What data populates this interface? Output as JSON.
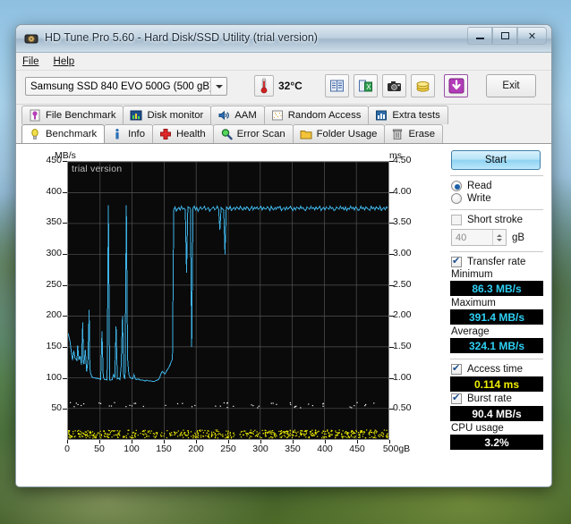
{
  "window": {
    "title": "HD Tune Pro 5.60 - Hard Disk/SSD Utility (trial version)",
    "app_icon": "harddisk-icon",
    "minimize_label": "Minimize",
    "maximize_label": "Maximize",
    "close_label": "✕"
  },
  "menu": {
    "items": [
      {
        "label": "File"
      },
      {
        "label": "Help"
      }
    ]
  },
  "toolbar": {
    "drive_selected": "Samsung SSD 840 EVO 500G (500 gB)",
    "temperature": "32°C",
    "buttons": [
      {
        "name": "copy-report-icon",
        "label": "Copy"
      },
      {
        "name": "export-excel-icon",
        "label": "Export"
      },
      {
        "name": "screenshot-icon",
        "label": "Screenshot"
      },
      {
        "name": "info-coins-icon",
        "label": "Options"
      },
      {
        "name": "download-icon",
        "label": "Save"
      }
    ],
    "exit_label": "Exit"
  },
  "tabs": {
    "top_row": [
      {
        "label": "File Benchmark",
        "icon": "file-benchmark-icon",
        "active": false
      },
      {
        "label": "Disk monitor",
        "icon": "disk-monitor-icon",
        "active": false
      },
      {
        "label": "AAM",
        "icon": "speaker-icon",
        "active": false
      },
      {
        "label": "Random Access",
        "icon": "random-access-icon",
        "active": false
      },
      {
        "label": "Extra tests",
        "icon": "extra-tests-icon",
        "active": false
      }
    ],
    "bottom_row": [
      {
        "label": "Benchmark",
        "icon": "lightbulb-icon",
        "active": true
      },
      {
        "label": "Info",
        "icon": "info-icon",
        "active": false
      },
      {
        "label": "Health",
        "icon": "health-cross-icon",
        "active": false
      },
      {
        "label": "Error Scan",
        "icon": "magnifier-icon",
        "active": false
      },
      {
        "label": "Folder Usage",
        "icon": "folder-icon",
        "active": false
      },
      {
        "label": "Erase",
        "icon": "trash-icon",
        "active": false
      }
    ]
  },
  "sidebar": {
    "start_label": "Start",
    "mode": {
      "read_label": "Read",
      "write_label": "Write",
      "read_selected": true,
      "write_selected": false
    },
    "short_stroke": {
      "label": "Short stroke",
      "checked": false,
      "value": "40",
      "unit": "gB"
    },
    "transfer_rate": {
      "label": "Transfer rate",
      "checked": true
    },
    "stats": [
      {
        "label": "Minimum",
        "value": "86.3 MB/s",
        "color": "cyan"
      },
      {
        "label": "Maximum",
        "value": "391.4 MB/s",
        "color": "cyan"
      },
      {
        "label": "Average",
        "value": "324.1 MB/s",
        "color": "cyan"
      }
    ],
    "access_time": {
      "label": "Access time",
      "checked": true,
      "value": "0.114 ms",
      "color": "yellow"
    },
    "burst_rate": {
      "label": "Burst rate",
      "checked": true,
      "value": "90.4 MB/s",
      "color": "white"
    },
    "cpu_usage": {
      "label": "CPU usage",
      "value": "3.2%",
      "color": "white"
    }
  },
  "chart_data": {
    "type": "line",
    "title": "",
    "watermark": "trial version",
    "xlabel": "",
    "ylabel": "MB/s",
    "y2label": "ms",
    "xlim": [
      0,
      500
    ],
    "ylim": [
      0,
      450
    ],
    "y2lim": [
      0,
      4.5
    ],
    "x_unit": "gB",
    "xticks": [
      "0",
      "50",
      "100",
      "150",
      "200",
      "250",
      "300",
      "350",
      "400",
      "450",
      "500gB"
    ],
    "xtick_values": [
      0,
      50,
      100,
      150,
      200,
      250,
      300,
      350,
      400,
      450,
      500
    ],
    "yticks": [
      "50",
      "100",
      "150",
      "200",
      "250",
      "300",
      "350",
      "400",
      "450"
    ],
    "ytick_values": [
      50,
      100,
      150,
      200,
      250,
      300,
      350,
      400,
      450
    ],
    "y2ticks": [
      "0.50",
      "1.00",
      "1.50",
      "2.00",
      "2.50",
      "3.00",
      "3.50",
      "4.00",
      "4.50"
    ],
    "y2tick_values": [
      0.5,
      1.0,
      1.5,
      2.0,
      2.5,
      3.0,
      3.5,
      4.0,
      4.5
    ],
    "grid": true,
    "legend_position": "none",
    "colors": {
      "transfer_rate": "#3fb4e8",
      "access_time": "#f2f200",
      "background": "#0a0a0a",
      "grid": "#6d6d6d"
    },
    "series": [
      {
        "name": "Transfer rate",
        "axis": "left",
        "unit": "MB/s",
        "color": "#3fb4e8",
        "x": [
          0,
          3,
          5,
          7,
          9,
          11,
          13,
          14,
          15,
          17,
          19,
          21,
          23,
          24,
          25,
          27,
          29,
          31,
          33,
          34,
          35,
          37,
          39,
          41,
          43,
          45,
          47,
          49,
          51,
          53,
          55,
          57,
          59,
          61,
          63,
          65,
          67,
          69,
          71,
          73,
          75,
          77,
          79,
          81,
          83,
          85,
          87,
          89,
          91,
          93,
          95,
          97,
          99,
          101,
          103,
          105,
          107,
          109,
          111,
          113,
          115,
          117,
          119,
          121,
          123,
          125,
          127,
          129,
          131,
          133,
          135,
          137,
          139,
          141,
          143,
          145,
          147,
          149,
          151,
          153,
          155,
          157,
          159,
          161,
          163,
          165,
          167,
          169,
          171,
          173,
          175,
          177,
          179,
          181,
          183,
          185,
          187,
          189,
          191,
          193,
          195,
          197,
          199,
          201,
          203,
          205,
          207,
          209,
          211,
          213,
          215,
          217,
          219,
          221,
          223,
          225,
          227,
          229,
          231,
          233,
          235,
          237,
          239,
          241,
          243,
          245,
          247,
          249,
          251,
          253,
          255,
          257,
          259,
          261,
          263,
          265,
          267,
          269,
          271,
          273,
          275,
          277,
          279,
          281,
          283,
          285,
          287,
          289,
          291,
          293,
          295,
          297,
          299,
          301,
          303,
          305,
          307,
          309,
          311,
          313,
          315,
          317,
          319,
          321,
          323,
          325,
          327,
          329,
          331,
          333,
          335,
          337,
          339,
          341,
          343,
          345,
          347,
          349,
          351,
          353,
          355,
          357,
          359,
          361,
          363,
          365,
          367,
          369,
          371,
          373,
          375,
          377,
          379,
          381,
          383,
          385,
          387,
          389,
          391,
          393,
          395,
          397,
          399,
          401,
          403,
          405,
          407,
          409,
          411,
          413,
          415,
          417,
          419,
          421,
          423,
          425,
          427,
          429,
          431,
          433,
          435,
          437,
          439,
          441,
          443,
          445,
          447,
          449,
          451,
          453,
          455,
          457,
          459,
          461,
          463,
          465,
          467,
          469,
          471,
          473,
          475,
          477,
          479,
          481,
          483,
          485,
          487,
          489,
          491,
          493,
          495,
          497,
          499
        ],
        "y": [
          172,
          160,
          143,
          128,
          144,
          131,
          130,
          127,
          152,
          129,
          135,
          121,
          190,
          125,
          122,
          145,
          110,
          125,
          210,
          118,
          108,
          102,
          100,
          100,
          99,
          99,
          98,
          98,
          97,
          175,
          100,
          97,
          97,
          96,
          380,
          96,
          96,
          97,
          105,
          100,
          183,
          98,
          99,
          97,
          120,
          200,
          102,
          98,
          380,
          130,
          105,
          100,
          99,
          98,
          105,
          98,
          97,
          98,
          97,
          96,
          96,
          96,
          95,
          95,
          96,
          95,
          95,
          95,
          94,
          94,
          94,
          95,
          96,
          97,
          100,
          106,
          110,
          108,
          106,
          109,
          113,
          116,
          120,
          126,
          130,
          372,
          377,
          370,
          374,
          376,
          372,
          378,
          373,
          375,
          372,
          270,
          377,
          376,
          374,
          150,
          375,
          378,
          372,
          376,
          370,
          374,
          377,
          373,
          375,
          378,
          372,
          374,
          376,
          370,
          373,
          375,
          377,
          372,
          374,
          378,
          373,
          340,
          376,
          374,
          372,
          300,
          377,
          375,
          373,
          378,
          371,
          374,
          376,
          372,
          377,
          375,
          373,
          378,
          374,
          372,
          376,
          373,
          377,
          375,
          371,
          374,
          378,
          372,
          376,
          374,
          377,
          373,
          375,
          378,
          372,
          376,
          374,
          373,
          377,
          375,
          371,
          378,
          374,
          372,
          376,
          373,
          377,
          375,
          378,
          371,
          374,
          376,
          372,
          377,
          373,
          375,
          378,
          374,
          371,
          376,
          372,
          377,
          375,
          373,
          378,
          374,
          376,
          372,
          371,
          377,
          375,
          373,
          378,
          374,
          376,
          372,
          377,
          373,
          375,
          378,
          371,
          374,
          376,
          372,
          377,
          375,
          373,
          378,
          374,
          376,
          371,
          372,
          377,
          375,
          373,
          378,
          374,
          376,
          372,
          377,
          371,
          375,
          373,
          378,
          374,
          376,
          372,
          377,
          375,
          371,
          373,
          378,
          374,
          376,
          372,
          377,
          375,
          373,
          371,
          378,
          374,
          376,
          372,
          377,
          375,
          373,
          378,
          371,
          374,
          376,
          372,
          377,
          375,
          373,
          378,
          374,
          371,
          376,
          372,
          377
        ]
      },
      {
        "name": "Access time",
        "axis": "right",
        "unit": "ms",
        "color": "#f2f200",
        "average": 0.114
      }
    ],
    "summary": {
      "minimum_mbps": 86.3,
      "maximum_mbps": 391.4,
      "average_mbps": 324.1,
      "access_time_ms": 0.114,
      "burst_rate_mbps": 90.4,
      "cpu_usage_percent": 3.2
    }
  }
}
